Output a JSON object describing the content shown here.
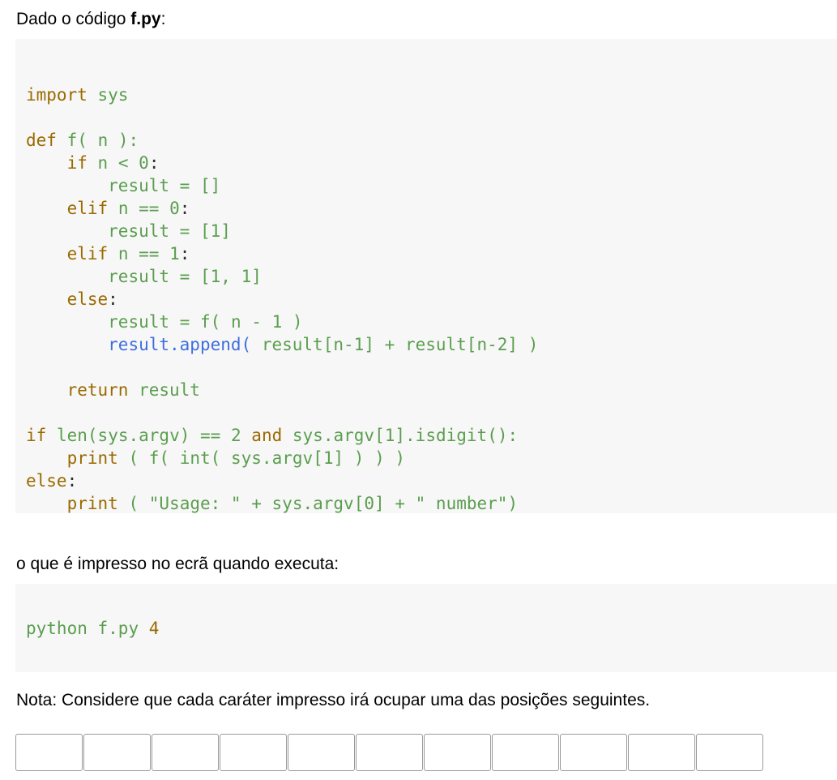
{
  "intro": {
    "prefix": "Dado o código ",
    "filename": "f.py",
    "suffix": ":"
  },
  "code": {
    "lines": [
      "",
      "import sys",
      "",
      "def f( n ):",
      "    if n < 0:",
      "        result = []",
      "    elif n == 0:",
      "        result = [1]",
      "    elif n == 1:",
      "        result = [1, 1]",
      "    else:",
      "        result = f( n - 1 )",
      "        result.append( result[n-1] + result[n-2] )",
      "",
      "    return result",
      "",
      "if len(sys.argv) == 2 and sys.argv[1].isdigit():",
      "    print ( f( int( sys.argv[1] ) ) )",
      "else:",
      "    print ( \"Usage: \" + sys.argv[0] + \" number\")"
    ]
  },
  "question": "o que é impresso no ecrã quando executa:",
  "command": {
    "program": "python",
    "file": "f.py",
    "arg": "4"
  },
  "note": "Nota: Considere que cada caráter impresso irá ocupar uma das posições seguintes.",
  "answer_cells": [
    "",
    "",
    "",
    "",
    "",
    "",
    "",
    "",
    "",
    "",
    ""
  ],
  "colors": {
    "keyword": "#9a6a00",
    "name": "#5a9e4e",
    "method": "#3d6ede",
    "code_bg": "#f7f7f7"
  }
}
